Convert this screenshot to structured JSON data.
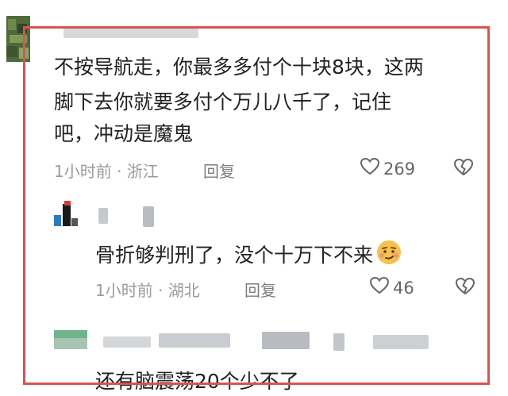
{
  "comments": [
    {
      "id": 1,
      "lines": [
        "不按导航走，你最多多付个十块8块，这两",
        "脚下去你就要多付个万儿八千了，记住",
        "吧，冲动是魔鬼"
      ],
      "meta": "1小时前 · 浙江",
      "reply_label": "回复",
      "likes": "269"
    },
    {
      "id": 2,
      "text": "骨折够判刑了，没个十万下不来",
      "emoji": "smirking-face-emoji",
      "meta": "1小时前 · 湖北",
      "reply_label": "回复",
      "likes": "46"
    },
    {
      "id": 3,
      "text_partial": "还有脑震荡20个少不了"
    }
  ],
  "icons": {
    "like": "heart-outline-icon",
    "dislike": "broken-heart-icon"
  },
  "colors": {
    "frame": "#d9534f",
    "text": "#222222",
    "meta": "#9a9a9a"
  }
}
